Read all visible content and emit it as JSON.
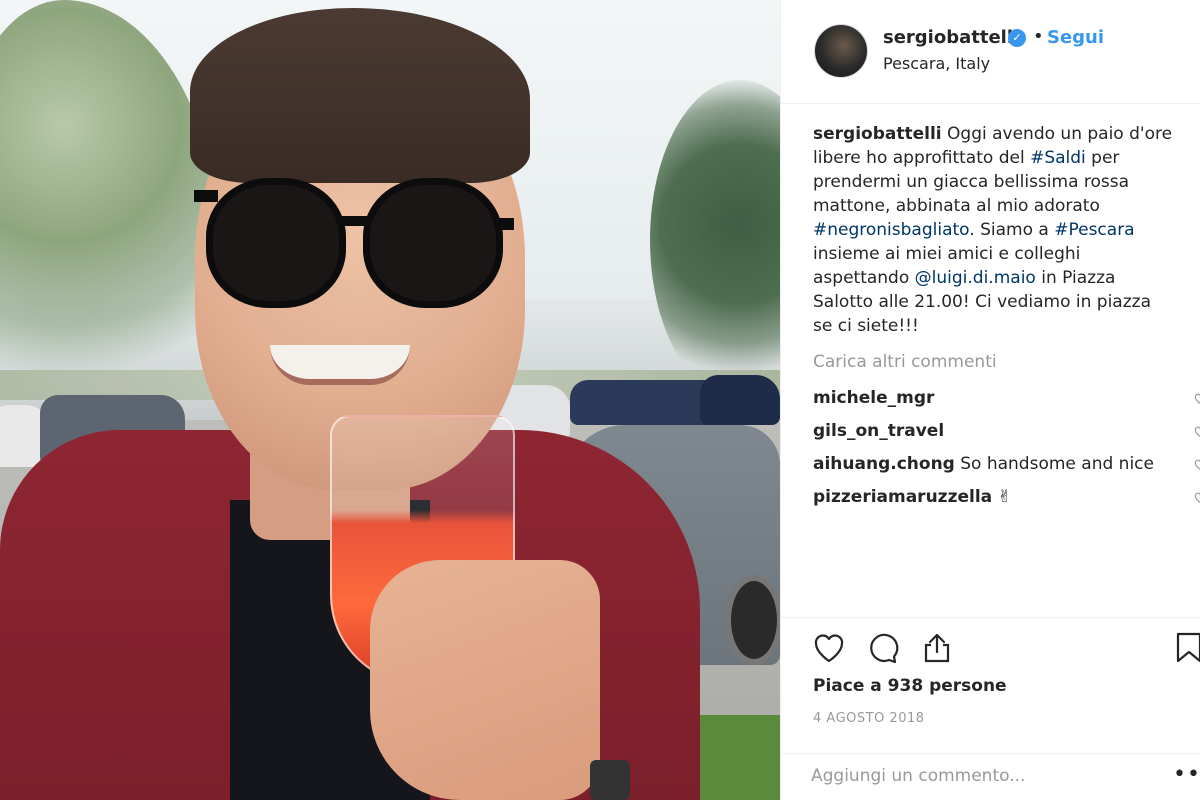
{
  "post": {
    "photo_alt": "",
    "author": "sergiobattelli",
    "verified": true,
    "follow_label": "Segui",
    "dot": "•",
    "location": "Pescara, Italy"
  },
  "caption": {
    "username": "sergiobattelli",
    "text_1": " Oggi avendo un paio d'ore libere ho approfittato del ",
    "tag_1": "#Saldi",
    "text_2": " per prendermi un giacca bellissima rossa mattone, abbinata al mio adorato ",
    "tag_2": "#negronisbagliato",
    "text_3": ". Siamo a ",
    "tag_3": "#Pescara",
    "text_4": " insieme ai miei amici e colleghi aspettando ",
    "tag_4": "@luigi.di.maio",
    "text_5": " in Piazza Salotto alle 21.00! Ci vediamo in piazza se ci siete!!!"
  },
  "load_more_label": "Carica altri commenti",
  "comments": [
    {
      "user": "michele_mgr",
      "text": ""
    },
    {
      "user": "gils_on_travel",
      "text": ""
    },
    {
      "user": "aihuang.chong",
      "text": " So handsome and nice"
    },
    {
      "user": "pizzeriamaruzzella",
      "text": " ✌"
    }
  ],
  "likes_label": "Piace a 938 persone",
  "date_label": "4 AGOSTO 2018",
  "add_comment_placeholder": "Aggiungi un commento...",
  "more_options": "•••",
  "colors": {
    "link": "#003569",
    "follow": "#3897f0",
    "muted": "#999999",
    "text": "#262626"
  },
  "icons": [
    "verified-badge-icon",
    "heart-icon",
    "comment-icon",
    "share-icon",
    "bookmark-icon",
    "more-options-icon"
  ]
}
